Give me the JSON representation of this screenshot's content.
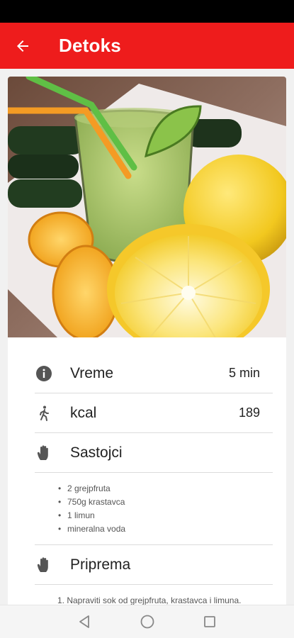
{
  "app": {
    "title": "Detoks"
  },
  "details": {
    "time_label": "Vreme",
    "time_value": "5 min",
    "kcal_label": "kcal",
    "kcal_value": "189",
    "ingredients_label": "Sastojci",
    "ingredients": [
      "2 grejpfruta",
      "750g krastavca",
      "1 limun",
      "mineralna voda"
    ],
    "preparation_label": "Priprema",
    "steps": [
      "Napraviti sok od grejpfruta, krastavca i limuna."
    ]
  },
  "icons": {
    "back": "arrow-left-icon",
    "time": "info-icon",
    "kcal": "walking-person-icon",
    "ingredients": "hand-icon",
    "preparation": "hand-icon",
    "nav_back": "triangle-back-icon",
    "nav_home": "circle-home-icon",
    "nav_recent": "square-recent-icon"
  },
  "colors": {
    "accent": "#ee1c1c",
    "statusbar": "#000000"
  }
}
